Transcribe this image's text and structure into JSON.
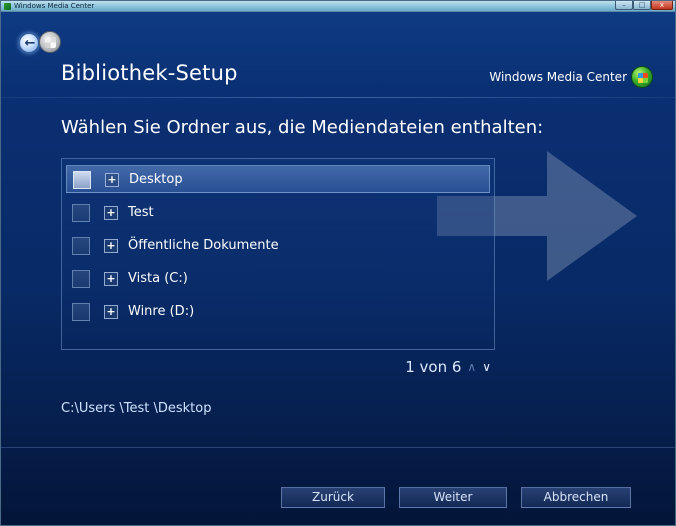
{
  "window": {
    "title": "Windows Media Center",
    "controls": {
      "minimize": "–",
      "maximize": "□",
      "close": "x"
    }
  },
  "header": {
    "title": "Bibliothek-Setup",
    "brand": "Windows Media Center"
  },
  "main": {
    "subtitle": "Wählen Sie Ordner aus, die Mediendateien enthalten:",
    "folders": [
      {
        "label": "Desktop",
        "expand": "+",
        "selected": true
      },
      {
        "label": "Test",
        "expand": "+",
        "selected": false
      },
      {
        "label": "Öffentliche Dokumente",
        "expand": "+",
        "selected": false
      },
      {
        "label": "Vista (C:)",
        "expand": "+",
        "selected": false
      },
      {
        "label": "Winre (D:)",
        "expand": "+",
        "selected": false
      }
    ],
    "pager": {
      "text": "1 von 6",
      "up": "∧",
      "down": "∨"
    },
    "path": "C:\\Users \\Test \\Desktop"
  },
  "footer": {
    "back_label": "Zurück",
    "next_label": "Weiter",
    "cancel_label": "Abbrechen"
  },
  "icons": {
    "back": "back-arrow-icon",
    "home": "windows-start-icon",
    "brand": "media-center-logo-icon"
  },
  "colors": {
    "background": "#0a2f72",
    "text": "#ffffff",
    "accent": "#cfe2ff"
  }
}
